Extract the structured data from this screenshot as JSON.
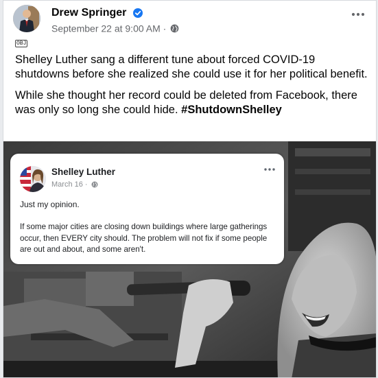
{
  "post": {
    "author": "Drew Springer",
    "timestamp": "September 22 at 9:00 AM",
    "separator": "·",
    "more_icon": "more-horizontal-icon",
    "badge": "OBJ",
    "paragraphs": [
      "Shelley Luther sang a different tune about forced COVID-19 shutdowns before she realized she could use it for her political benefit.",
      "While she thought her record could be deleted from Facebook, there was only so long she could hide."
    ],
    "hashtag": "#ShutdownShelley"
  },
  "embedded_post": {
    "author": "Shelley Luther",
    "timestamp": "March 16",
    "separator": "·",
    "line1": "Just my opinion.",
    "body": "If some major cities are closing down buildings where large gatherings occur, then EVERY city should. The problem will not fix if some people are out and about, and some aren't."
  },
  "colors": {
    "verified": "#1877f2",
    "secondary_text": "#65676b",
    "primary_text": "#050505"
  }
}
